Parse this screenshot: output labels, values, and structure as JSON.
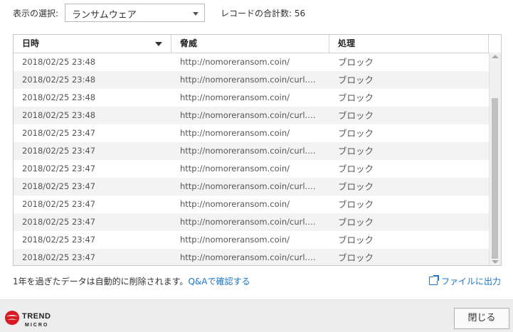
{
  "filter": {
    "label": "表示の選択:",
    "selected": "ランサムウェア",
    "record_count": "レコードの合計数: 56"
  },
  "table": {
    "columns": [
      "日時",
      "脅威",
      "処理"
    ],
    "rows": [
      {
        "time": "2018/02/25 23:48",
        "threat": "http://nomoreransom.coin/",
        "action": "ブロック"
      },
      {
        "time": "2018/02/25 23:48",
        "threat": "http://nomoreransom.coin/curl.ph...",
        "action": "ブロック"
      },
      {
        "time": "2018/02/25 23:48",
        "threat": "http://nomoreransom.coin/",
        "action": "ブロック"
      },
      {
        "time": "2018/02/25 23:48",
        "threat": "http://nomoreransom.coin/curl.ph...",
        "action": "ブロック"
      },
      {
        "time": "2018/02/25 23:47",
        "threat": "http://nomoreransom.coin/",
        "action": "ブロック"
      },
      {
        "time": "2018/02/25 23:47",
        "threat": "http://nomoreransom.coin/curl.ph...",
        "action": "ブロック"
      },
      {
        "time": "2018/02/25 23:47",
        "threat": "http://nomoreransom.coin/",
        "action": "ブロック"
      },
      {
        "time": "2018/02/25 23:47",
        "threat": "http://nomoreransom.coin/curl.ph...",
        "action": "ブロック"
      },
      {
        "time": "2018/02/25 23:47",
        "threat": "http://nomoreransom.coin/",
        "action": "ブロック"
      },
      {
        "time": "2018/02/25 23:47",
        "threat": "http://nomoreransom.coin/curl.ph...",
        "action": "ブロック"
      },
      {
        "time": "2018/02/25 23:47",
        "threat": "http://nomoreransom.coin/",
        "action": "ブロック"
      },
      {
        "time": "2018/02/25 23:47",
        "threat": "http://nomoreransom.coin/curl.ph...",
        "action": "ブロック"
      }
    ]
  },
  "footer": {
    "note": "1年を過ぎたデータは自動的に削除されます。",
    "qa_link": "Q&Aで確認する",
    "export_label": "ファイルに出力",
    "close_label": "閉じる",
    "logo_text_1": "TREND",
    "logo_text_2": "MICRO"
  },
  "colors": {
    "link": "#1a75c9",
    "logo_red": "#d71921"
  },
  "icons": {
    "export": "export-icon",
    "sort": "sort-desc-icon",
    "dropdown": "chevron-down-icon"
  }
}
